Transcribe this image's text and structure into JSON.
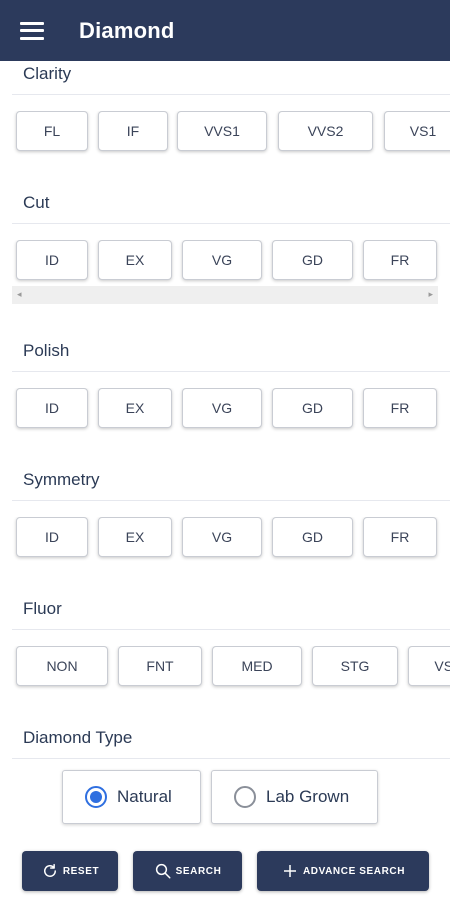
{
  "appbar": {
    "title": "Diamond",
    "menu_icon": "hamburger-menu-icon"
  },
  "sections": {
    "clarity": {
      "title": "Clarity",
      "options": [
        "FL",
        "IF",
        "VVS1",
        "VVS2",
        "VS1"
      ]
    },
    "cut": {
      "title": "Cut",
      "options": [
        "ID",
        "EX",
        "VG",
        "GD",
        "FR"
      ]
    },
    "polish": {
      "title": "Polish",
      "options": [
        "ID",
        "EX",
        "VG",
        "GD",
        "FR"
      ]
    },
    "symmetry": {
      "title": "Symmetry",
      "options": [
        "ID",
        "EX",
        "VG",
        "GD",
        "FR"
      ]
    },
    "fluor": {
      "title": "Fluor",
      "options": [
        "NON",
        "FNT",
        "MED",
        "STG",
        "VST"
      ]
    },
    "diamond_type": {
      "title": "Diamond Type",
      "options": [
        {
          "label": "Natural",
          "selected": true
        },
        {
          "label": "Lab Grown",
          "selected": false
        }
      ]
    }
  },
  "scrollbar": {
    "left_arrow": "◂",
    "right_arrow": "▸"
  },
  "actions": {
    "reset": {
      "label": "RESET",
      "icon": "refresh-icon"
    },
    "search": {
      "label": "SEARCH",
      "icon": "search-icon"
    },
    "advance_search": {
      "label": "ADVANCE SEARCH",
      "icon": "plus-icon"
    }
  },
  "colors": {
    "primary": "#2c3a5c",
    "radio_active": "#2f6fe0",
    "chip_border": "#c9ccd3"
  }
}
